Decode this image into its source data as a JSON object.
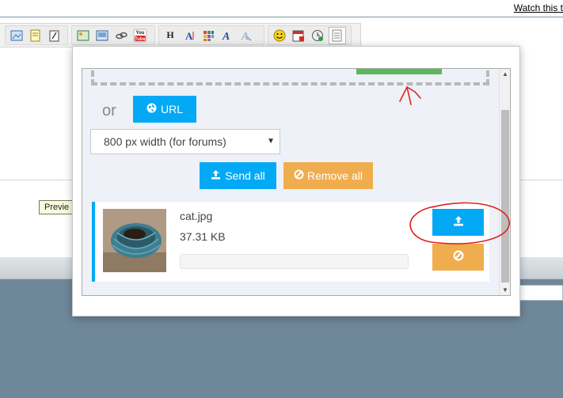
{
  "background": {
    "watch_link": "Watch this t",
    "preview_button": "Previe",
    "toolbar_icons": {
      "group1": [
        "image-icon",
        "note-icon",
        "clipboard-icon"
      ],
      "group2": [
        "insert-image-icon",
        "media-icon",
        "link-icon",
        "youtube-icon"
      ],
      "group3": [
        "heading-icon",
        "font-size-icon",
        "color-grid-icon",
        "font-icon",
        "clear-format-icon"
      ],
      "group4": [
        "smiley-icon",
        "calendar-icon",
        "clock-icon",
        "page-icon"
      ]
    },
    "youtube_label": "You Tube",
    "heading_label": "H"
  },
  "uploader": {
    "or_label": "or",
    "url_button": "URL",
    "width_select": {
      "selected": "800 px width (for forums)"
    },
    "send_all_button": "Send all",
    "remove_all_button": "Remove all",
    "file": {
      "name": "cat.jpg",
      "size": "37.31 KB",
      "progress": 0
    }
  },
  "colors": {
    "accent_blue": "#03a9f4",
    "warning_orange": "#f0ad4e",
    "progress_green": "#5cb85c",
    "annotation_red": "#e02020"
  }
}
